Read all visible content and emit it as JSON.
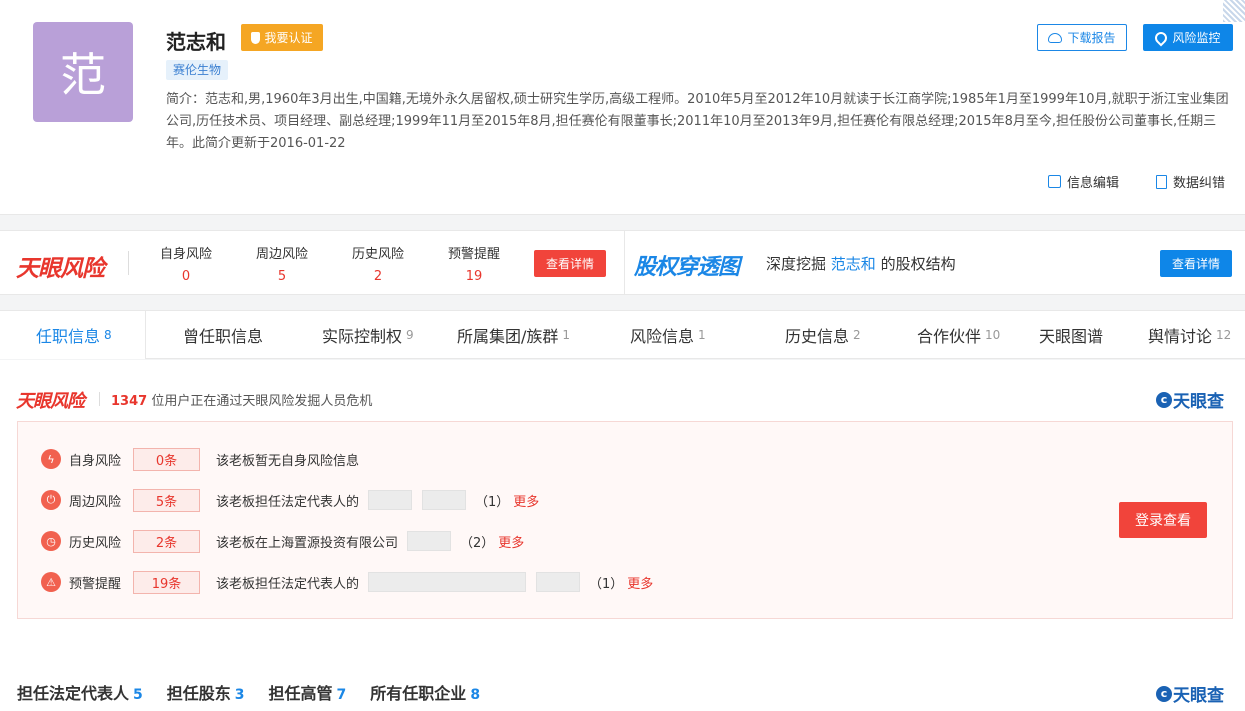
{
  "profile": {
    "avatar_char": "范",
    "name": "范志和",
    "certify_label": "我要认证",
    "company_tag": "赛伦生物",
    "intro": "简介：范志和,男,1960年3月出生,中国籍,无境外永久居留权,硕士研究生学历,高级工程师。2010年5月至2012年10月就读于长江商学院;1985年1月至1999年10月,就职于浙江宝业集团公司,历任技术员、项目经理、副总经理;1999年11月至2015年8月,担任赛伦有限董事长;2011年10月至2013年9月,担任赛伦有限总经理;2015年8月至今,担任股份公司董事长,任期三年。此简介更新于2016-01-22",
    "download_label": "下载报告",
    "monitor_label": "风险监控",
    "edit_label": "信息编辑",
    "correct_label": "数据纠错"
  },
  "risk_strip": {
    "brand": "天眼风险",
    "stats": [
      {
        "label": "自身风险",
        "value": "0"
      },
      {
        "label": "周边风险",
        "value": "5"
      },
      {
        "label": "历史风险",
        "value": "2"
      },
      {
        "label": "预警提醒",
        "value": "19"
      }
    ],
    "detail_label": "查看详情",
    "equity_brand": "股权穿透图",
    "equity_prefix": "深度挖掘",
    "equity_name": "范志和",
    "equity_suffix": "的股权结构",
    "equity_detail_label": "查看详情"
  },
  "tabs": [
    {
      "label": "任职信息",
      "count": "8"
    },
    {
      "label": "曾任职信息",
      "count": ""
    },
    {
      "label": "实际控制权",
      "count": "9"
    },
    {
      "label": "所属集团/族群",
      "count": "1"
    },
    {
      "label": "风险信息",
      "count": "1"
    },
    {
      "label": "历史信息",
      "count": "2"
    },
    {
      "label": "合作伙伴",
      "count": "10"
    },
    {
      "label": "天眼图谱",
      "count": ""
    },
    {
      "label": "舆情讨论",
      "count": "12"
    }
  ],
  "risk_panel": {
    "brand": "天眼风险",
    "users_count": "1347",
    "users_text": "位用户正在通过天眼风险发掘人员危机",
    "logo_text": "天眼查",
    "rows": [
      {
        "label": "自身风险",
        "count": "0条",
        "desc": "该老板暂无自身风险信息",
        "paren": "",
        "more": ""
      },
      {
        "label": "周边风险",
        "count": "5条",
        "desc": "该老板担任法定代表人的",
        "paren": "（1）",
        "more": "更多"
      },
      {
        "label": "历史风险",
        "count": "2条",
        "desc": "该老板在上海置源投资有限公司",
        "paren": "（2）",
        "more": "更多"
      },
      {
        "label": "预警提醒",
        "count": "19条",
        "desc": "该老板担任法定代表人的",
        "paren": "（1）",
        "more": "更多"
      }
    ],
    "login_label": "登录查看"
  },
  "bottom_tabs": [
    {
      "label": "担任法定代表人",
      "count": "5"
    },
    {
      "label": "担任股东",
      "count": "3"
    },
    {
      "label": "担任高管",
      "count": "7"
    },
    {
      "label": "所有任职企业",
      "count": "8"
    }
  ],
  "colors": {
    "brand_blue": "#1b87e6",
    "risk_red": "#e8362d",
    "cert_orange": "#f5a623"
  }
}
